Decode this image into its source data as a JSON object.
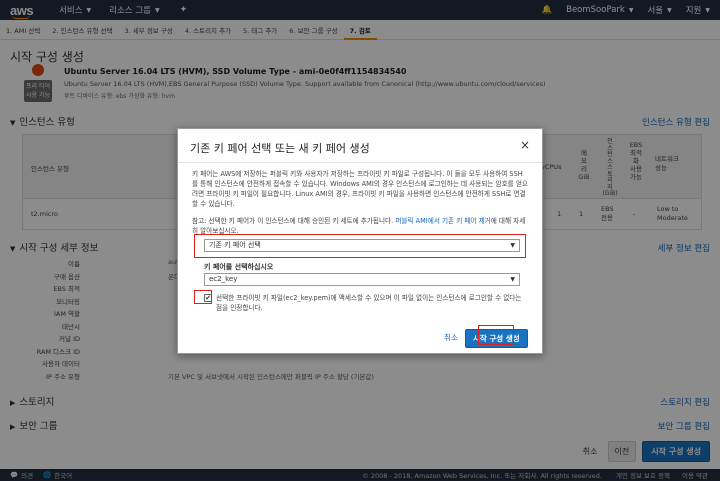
{
  "topnav": {
    "logo": "aws",
    "services": "서비스",
    "resource_groups": "리소스 그룹",
    "user": "BeomSooPark",
    "region": "서울",
    "support": "지원"
  },
  "steps": [
    "1. AMI 선택",
    "2. 인스턴스 유형 선택",
    "3. 세부 정보 구성",
    "4. 스토리지 추가",
    "5. 태그 추가",
    "6. 보안 그룹 구성",
    "7. 검토"
  ],
  "page_title": "시작 구성 생성",
  "ami": {
    "title": "Ubuntu Server 16.04 LTS (HVM), SSD Volume Type - ami-0e0f4ff1154834540",
    "badge_line1": "프리 티어",
    "badge_line2": "사용 가능",
    "desc": "Ubuntu Server 16.04 LTS (HVM),EBS General Purpose (SSD) Volume Type. Support available from Canonical (http://www.ubuntu.com/cloud/services)",
    "meta": "루트 디바이스 유형: ebs   가상화 유형: hvm"
  },
  "instance_section": {
    "title": "인스턴스 유형",
    "edit": "인스턴스 유형 편집"
  },
  "instance_table": {
    "headers": {
      "type": "인스턴스 유형",
      "vcpus": "vCPUs",
      "memory": [
        "메",
        "모",
        "리",
        "GiB"
      ],
      "storage": [
        "인",
        "스",
        "턴",
        "스",
        "스",
        "토",
        "리",
        "지",
        "(GiB)"
      ],
      "ebs": [
        "EBS",
        "최적",
        "화",
        "사용",
        "가능"
      ],
      "network": [
        "네트워크",
        "성능"
      ]
    },
    "row": {
      "type": "t2.micro",
      "vcpus": "1",
      "memory": "1",
      "storage_line1": "EBS",
      "storage_line2": "전용",
      "ebs": "-",
      "network_line1": "Low to",
      "network_line2": "Moderate"
    }
  },
  "details_section": {
    "title": "시작 구성 세부 정보",
    "edit": "세부 정보 편집"
  },
  "details": [
    {
      "key": "이름",
      "val": "aut"
    },
    {
      "key": "구매 옵션",
      "val": "온디"
    },
    {
      "key": "EBS 최적",
      "val": ""
    },
    {
      "key": "모니터링",
      "val": ""
    },
    {
      "key": "IAM 역할",
      "val": ""
    },
    {
      "key": "테넌시",
      "val": ""
    },
    {
      "key": "커널 ID",
      "val": ""
    },
    {
      "key": "RAM 디스크 ID",
      "val": ""
    },
    {
      "key": "사용자 데이터",
      "val": ""
    },
    {
      "key": "IP 주소 유형",
      "val": "기본 VPC 및 서브넷에서 시작된 인스턴스에만 퍼블릭 IP 주소 할당 (기본값)"
    }
  ],
  "storage_section": {
    "title": "스토리지",
    "edit": "스토리지 편집"
  },
  "security_section": {
    "title": "보안 그룹",
    "edit": "보안 그룹 편집"
  },
  "footer": {
    "cancel": "취소",
    "prev": "이전",
    "create": "시작 구성 생성"
  },
  "statusbar": {
    "feedback": "의견",
    "language": "한국어",
    "copyright": "© 2008 - 2018, Amazon Web Services, Inc. 또는 자회사. All rights reserved.",
    "privacy": "개인 정보 보호 정책",
    "terms": "이용 약관"
  },
  "modal": {
    "title": "기존 키 페어 선택 또는 새 키 페어 생성",
    "close": "×",
    "para1": "키 페어는 AWS에 저장하는 퍼블릭 키와 사용자가 저장하는 프라이빗 키 파일로 구성됩니다. 이 둘을 모두 사용하여 SSH를 통해 인스턴스에 안전하게 접속할 수 있습니다. Windows AMI의 경우 인스턴스에 로그인하는 데 사용되는 암호를 얻으려면 프라이빗 키 파일이 필요합니다. Linux AMI의 경우, 프라이빗 키 파일을 사용하면 인스턴스에 안전하게 SSH로 연결할 수 있습니다.",
    "para2_prefix": "참고: 선택한 키 페어가 이 인스턴스에 대해 승인된 키 세트에 추가됩니다.",
    "para2_link": "퍼블릭 AMI에서 기존 키 페어 제거",
    "para2_suffix": "에 대해 자세히 알아보십시오.",
    "select1": "기존 키 페어 선택",
    "key_label": "키 페어를 선택하십시오",
    "select2": "ec2_key",
    "ack": "선택한 프라이빗 키 파일(ec2_key.pem)에 액세스할 수 있으며 이 파일 없이는 인스턴스에 로그인할 수 없다는 점을 인정합니다.",
    "checkbox_mark": "✔",
    "cancel": "취소",
    "launch": "시작 구성 생성"
  }
}
